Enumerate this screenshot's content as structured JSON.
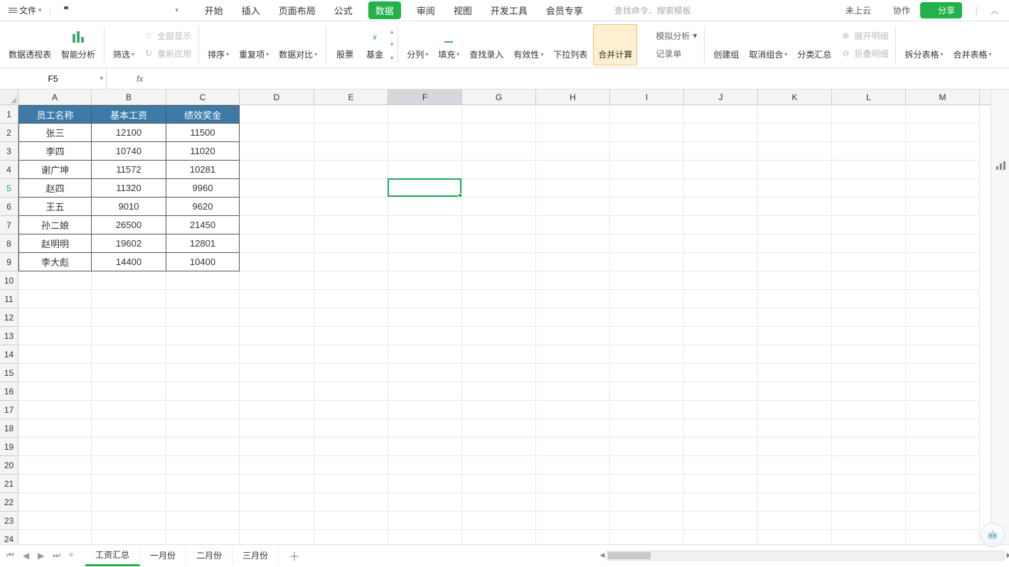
{
  "menubar": {
    "file_label": "文件",
    "tabs": [
      "开始",
      "插入",
      "页面布局",
      "公式",
      "数据",
      "审阅",
      "视图",
      "开发工具",
      "会员专享"
    ],
    "active_tab_index": 4,
    "search_placeholder": "查找命令、搜索模板",
    "cloud_label": "未上云",
    "collab_label": "协作",
    "share_label": "分享"
  },
  "ribbon": {
    "pivot": "数据透视表",
    "smart": "智能分析",
    "filter": "筛选",
    "show_all": "全部显示",
    "reapply": "重新应用",
    "sort": "排序",
    "dup": "重复项",
    "compare": "数据对比",
    "stock": "股票",
    "fund": "基金",
    "split": "分列",
    "fill": "填充",
    "find_entry": "查找录入",
    "validity": "有效性",
    "dropdown": "下拉列表",
    "consolidate": "合并计算",
    "sim": "模拟分析",
    "record": "记录单",
    "group": "创建组",
    "ungroup": "取消组合",
    "subtotal": "分类汇总",
    "expand": "展开明细",
    "collapse": "折叠明细",
    "split_table": "拆分表格",
    "merge_table": "合并表格"
  },
  "namebox": "F5",
  "columns": [
    "A",
    "B",
    "C",
    "D",
    "E",
    "F",
    "G",
    "H",
    "I",
    "J",
    "K",
    "L",
    "M"
  ],
  "selected_col": "F",
  "selected_row": 5,
  "headers": [
    "员工名称",
    "基本工资",
    "绩效奖金"
  ],
  "data_rows": [
    [
      "张三",
      "12100",
      "11500"
    ],
    [
      "李四",
      "10740",
      "11020"
    ],
    [
      "谢广坤",
      "11572",
      "10281"
    ],
    [
      "赵四",
      "11320",
      "9960"
    ],
    [
      "王五",
      "9010",
      "9620"
    ],
    [
      "孙二娘",
      "26500",
      "21450"
    ],
    [
      "赵明明",
      "19602",
      "12801"
    ],
    [
      "李大彪",
      "14400",
      "10400"
    ]
  ],
  "total_rows": 24,
  "sheet_tabs": [
    "工资汇总",
    "一月份",
    "二月份",
    "三月份"
  ],
  "active_sheet": 0,
  "active_cell": {
    "col": "F",
    "row": 5
  }
}
